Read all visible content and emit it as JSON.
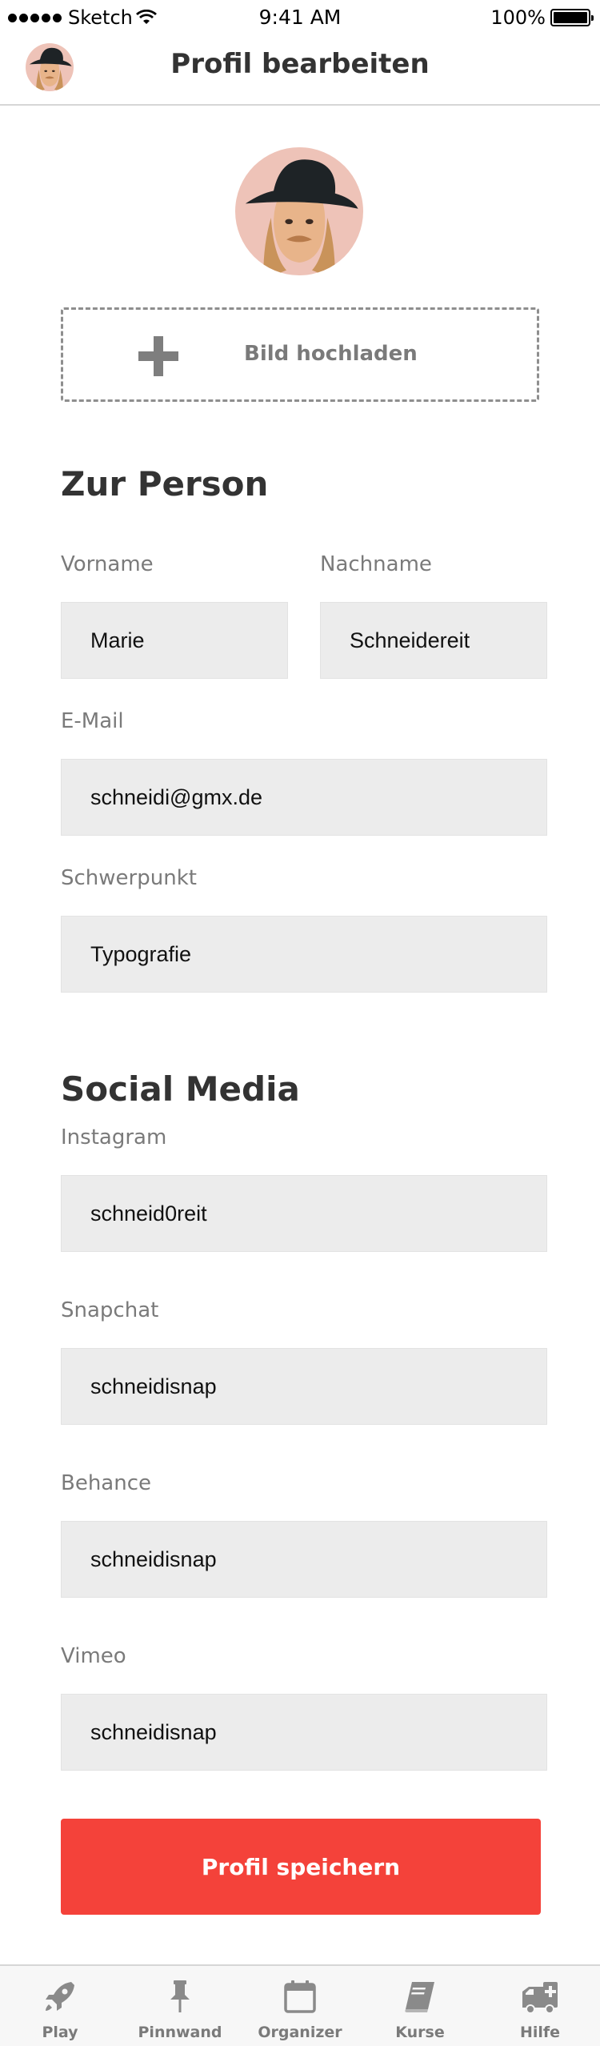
{
  "status_bar": {
    "carrier": "Sketch",
    "time": "9:41 AM",
    "battery": "100%"
  },
  "nav": {
    "title": "Profil bearbeiten"
  },
  "upload": {
    "label": "Bild hochladen"
  },
  "person": {
    "title": "Zur Person",
    "first_name_label": "Vorname",
    "first_name_value": "Marie",
    "last_name_label": "Nachname",
    "last_name_value": "Schneidereit",
    "email_label": "E-Mail",
    "email_value": "schneidi@gmx.de",
    "focus_label": "Schwerpunkt",
    "focus_value": "Typografie"
  },
  "social": {
    "title": "Social Media",
    "instagram_label": "Instagram",
    "instagram_value": "schneid0reit",
    "snapchat_label": "Snapchat",
    "snapchat_value": "schneidisnap",
    "behance_label": "Behance",
    "behance_value": "schneidisnap",
    "vimeo_label": "Vimeo",
    "vimeo_value": "schneidisnap"
  },
  "save_label": "Profil speichern",
  "tabs": [
    {
      "label": "Play",
      "icon": "rocket-icon"
    },
    {
      "label": "Pinnwand",
      "icon": "pin-icon"
    },
    {
      "label": "Organizer",
      "icon": "calendar-icon"
    },
    {
      "label": "Kurse",
      "icon": "book-icon"
    },
    {
      "label": "Hilfe",
      "icon": "ambulance-icon"
    }
  ],
  "colors": {
    "accent": "#f4423a",
    "field_bg": "#ececec",
    "label": "#7a7a7a",
    "heading": "#333333"
  }
}
